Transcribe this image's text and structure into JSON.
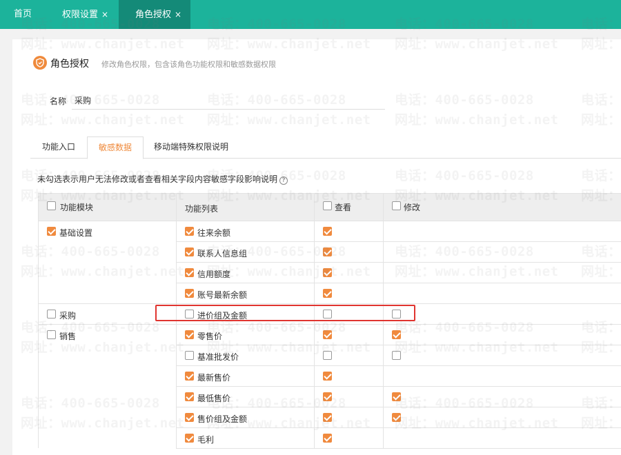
{
  "tabs": [
    {
      "label": "首页",
      "closable": false
    },
    {
      "label": "权限设置",
      "closable": true
    },
    {
      "label": "角色授权",
      "closable": true,
      "active": true
    }
  ],
  "close_glyph": "×",
  "header": {
    "icon": "shield-icon",
    "title": "角色授权",
    "subtitle": "修改角色权限，包含该角色功能权限和敏感数据权限"
  },
  "name_field": {
    "label": "名称",
    "value": "采购"
  },
  "subtabs": [
    {
      "label": "功能入口"
    },
    {
      "label": "敏感数据",
      "active": true
    },
    {
      "label": "移动端特殊权限说明"
    }
  ],
  "hint": "未勾选表示用户无法修改或者查看相关字段内容敏感字段影响说明",
  "table": {
    "headers": {
      "module": "功能模块",
      "fields": "功能列表",
      "view": "查看",
      "edit": "修改"
    },
    "modules": [
      {
        "label": "基础设置",
        "checked": true
      },
      {
        "label": "采购",
        "checked": false
      },
      {
        "label": "销售",
        "checked": false
      }
    ],
    "rows": [
      {
        "label": "往来余额",
        "checked": true,
        "view": true,
        "edit": null
      },
      {
        "label": "联系人信息组",
        "checked": true,
        "view": true,
        "edit": null
      },
      {
        "label": "信用额度",
        "checked": true,
        "view": true,
        "edit": null
      },
      {
        "label": "账号最新余额",
        "checked": true,
        "view": true,
        "edit": null
      },
      {
        "label": "进价组及金额",
        "checked": false,
        "view": false,
        "edit": false
      },
      {
        "label": "零售价",
        "checked": true,
        "view": true,
        "edit": true
      },
      {
        "label": "基准批发价",
        "checked": false,
        "view": false,
        "edit": false
      },
      {
        "label": "最新售价",
        "checked": true,
        "view": true,
        "edit": null
      },
      {
        "label": "最低售价",
        "checked": true,
        "view": true,
        "edit": true
      },
      {
        "label": "售价组及金额",
        "checked": true,
        "view": true,
        "edit": true
      },
      {
        "label": "毛利",
        "checked": true,
        "view": true,
        "edit": null
      }
    ]
  },
  "watermark": {
    "phone": "电话：400-665-0028",
    "site": "网址：www.chanjet.net"
  },
  "colors": {
    "topbar": "#1cb39b",
    "topbar_active": "#148a78",
    "accent": "#f08a3e",
    "highlight": "#e0342f"
  }
}
